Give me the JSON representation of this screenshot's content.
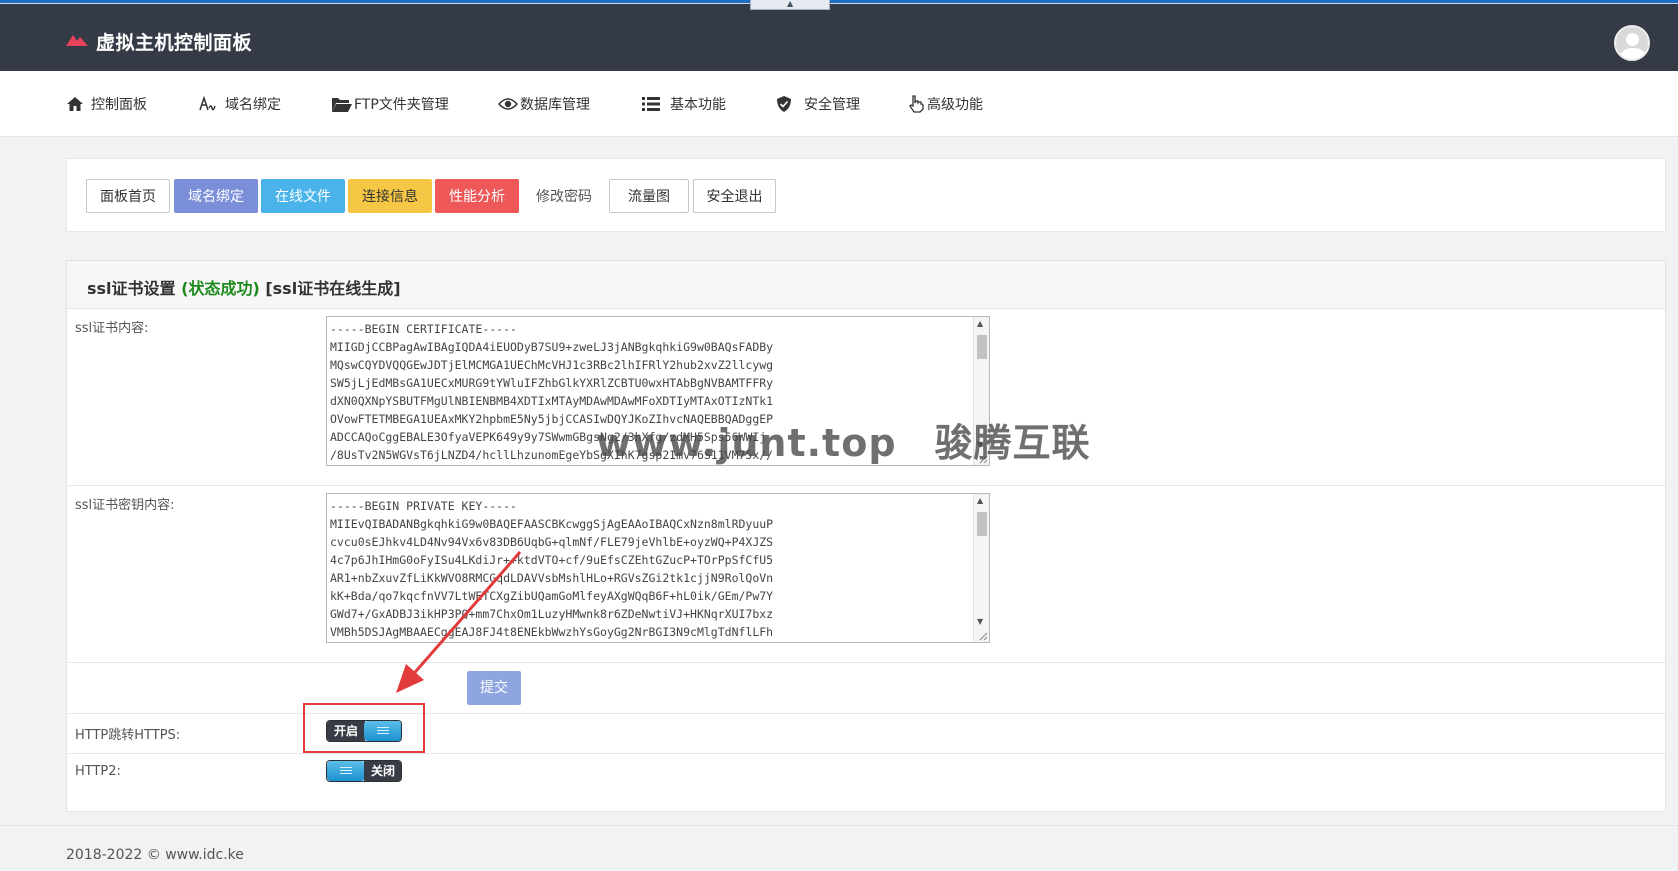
{
  "app": {
    "title": "虚拟主机控制面板"
  },
  "nav": [
    {
      "label": "控制面板",
      "icon": "home-icon"
    },
    {
      "label": "域名绑定",
      "icon": "signature-icon"
    },
    {
      "label": "FTP文件夹管理",
      "icon": "folder-open-icon"
    },
    {
      "label": "数据库管理",
      "icon": "eye-icon"
    },
    {
      "label": "基本功能",
      "icon": "list-icon"
    },
    {
      "label": "安全管理",
      "icon": "shield-icon"
    },
    {
      "label": "高级功能",
      "icon": "hand-pointer-icon"
    }
  ],
  "quick_buttons": [
    {
      "label": "面板首页",
      "style": "default"
    },
    {
      "label": "域名绑定",
      "style": "primary"
    },
    {
      "label": "在线文件",
      "style": "info"
    },
    {
      "label": "连接信息",
      "style": "warning"
    },
    {
      "label": "性能分析",
      "style": "danger"
    },
    {
      "label": "修改密码",
      "style": "flat"
    },
    {
      "label": "流量图",
      "style": "default"
    },
    {
      "label": "安全退出",
      "style": "default"
    }
  ],
  "ssl": {
    "title": "ssl证书设置",
    "status_open": "(",
    "status": "状态成功",
    "status_close": ")",
    "online_link": "[ssl证书在线生成]",
    "cert_label": "ssl证书内容:",
    "cert_value": "-----BEGIN CERTIFICATE-----\nMIIGDjCCBPagAwIBAgIQDA4iEUODyB7SU9+zweLJ3jANBgkqhkiG9w0BAQsFADBy\nMQswCQYDVQQGEwJDTjElMCMGA1UEChMcVHJ1c3RBc2lhIFRlY2hub2xvZ2llcywg\nSW5jLjEdMBsGA1UECxMURG9tYWluIFZhbGlkYXRlZCBTU0wxHTAbBgNVBAMTFFRy\ndXN0QXNpYSBUTFMgUlNBIENBMB4XDTIxMTAyMDAwMDAwMFoXDTIyMTAxOTIzNTk1\nOVowFTETMBEGA1UEAxMKY2hpbmE5Ny5jbjCCASIwDQYJKoZIhvcNAQEBBQADggEP\nADCCAQoCggEBALE3OfyaVEPK649y9y7SWwmGBgsNg2/3hXfg/zdMH5Sps56WWIj\n/8UsTv2N5WGVsT6jLNZD4/hcllLhzunomEgeYbSgXIhK7gsp2Imv76S11VM75x//",
    "key_label": "ssl证书密钥内容:",
    "key_value": "-----BEGIN PRIVATE KEY-----\nMIIEvQIBADANBgkqhkiG9w0BAQEFAASCBKcwggSjAgEAAoIBAQCxNzn8mlRDyuuP\ncvcu0sEJhkv4LD4Nv94Vx6v83DB6UqbG+qlmNf/FLE79jeVhlbE+oyzWQ+P4XJZS\n4c7p6JhIHmG0oFyISu4LKdiJr++ktdVTO+cf/9uEfsCZEhtGZucP+TOrPpSfCfU5\nAR1+nbZxuvZfLiKkWVO8RMCGqdLDAVVsbMshlHLo+RGVsZGi2tk1cjjN9RolQoVn\nkK+Bda/qo7kqcfnVV7LtWETCXgZibUQamGoMlfeyAXgWQqB6F+hL0ik/GEm/Pw7Y\nGWd7+/GxADBJ3ikHP3PQ+mm7ChxOm1LuzyHMwnk8r6ZDeNwtiVJ+HKNqrXUI7bxz\nVMBh5DSJAgMBAAECggEAJ8FJ4t8ENEkbWwzhYsGoyGg2NrBGI3N9cMlgTdNflLFh",
    "submit_label": "提交",
    "http_https_label": "HTTP跳转HTTPS:",
    "http_https_state": "开启",
    "http2_label": "HTTP2:",
    "http2_state": "关闭"
  },
  "watermark": {
    "url": "www.junt.top",
    "brand": "骏腾互联"
  },
  "footer": {
    "text": "2018-2022 © www.idc.ke"
  },
  "colors": {
    "topbar": "#353b46",
    "accent_logo": "#e8425c",
    "primary": "#7b8fd8",
    "info": "#4ab3ea",
    "warning": "#f6c744",
    "danger": "#ee5858",
    "success_text": "#1e8a1e",
    "annotation": "#e23b3b"
  }
}
